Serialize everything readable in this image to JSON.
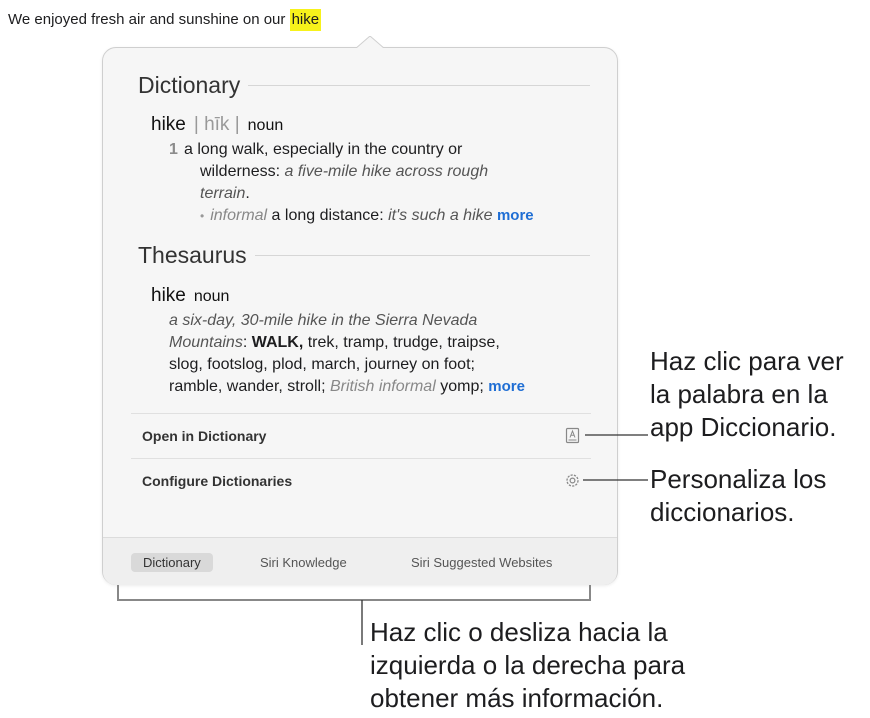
{
  "sentence": {
    "text": "We enjoyed fresh air and sunshine on our ",
    "highlight": "hike"
  },
  "dictionary": {
    "heading": "Dictionary",
    "headword": "hike",
    "pronunciation": "| hīk |",
    "pos": "noun",
    "sense_number": "1",
    "def_line1": "a long walk, especially in the country or",
    "def_line2_text": "wilderness: ",
    "def_line2_italic": "a five-mile hike across rough",
    "def_line3_italic": "terrain",
    "def_line3_end": ".",
    "bullet": "•",
    "sub_register": "informal",
    "sub_text": " a long distance: ",
    "sub_example": "it's such a hike",
    "more": "more"
  },
  "thesaurus": {
    "heading": "Thesaurus",
    "headword": "hike",
    "pos": "noun",
    "ex_line1": "a six-day, 30-mile hike in the Sierra Nevada",
    "ex_line2_italic": "Mountains",
    "ex_line2_colon": ": ",
    "ex_line2_bold": "WALK,",
    "ex_line2_rest": " trek, tramp, trudge, traipse,",
    "ex_line3": "slog, footslog, plod, march, journey on foot;",
    "ex_line4_start": "ramble, wander, stroll; ",
    "ex_line4_register": "British informal",
    "ex_line4_end": " yomp;",
    "more": "more"
  },
  "actions": {
    "open": {
      "label": "Open in Dictionary",
      "icon": "dictionary-book-icon"
    },
    "configure": {
      "label": "Configure Dictionaries",
      "icon": "gear-icon"
    }
  },
  "tabs": [
    "Dictionary",
    "Siri Knowledge",
    "Siri Suggested Websites"
  ],
  "active_tab": "Dictionary",
  "callouts": {
    "open": [
      "Haz clic para ver",
      "la palabra en la",
      "app Diccionario."
    ],
    "configure": [
      "Personaliza los",
      "diccionarios."
    ],
    "tabs": [
      "Haz clic o desliza hacia la",
      "izquierda o la derecha para",
      "obtener más información."
    ]
  }
}
